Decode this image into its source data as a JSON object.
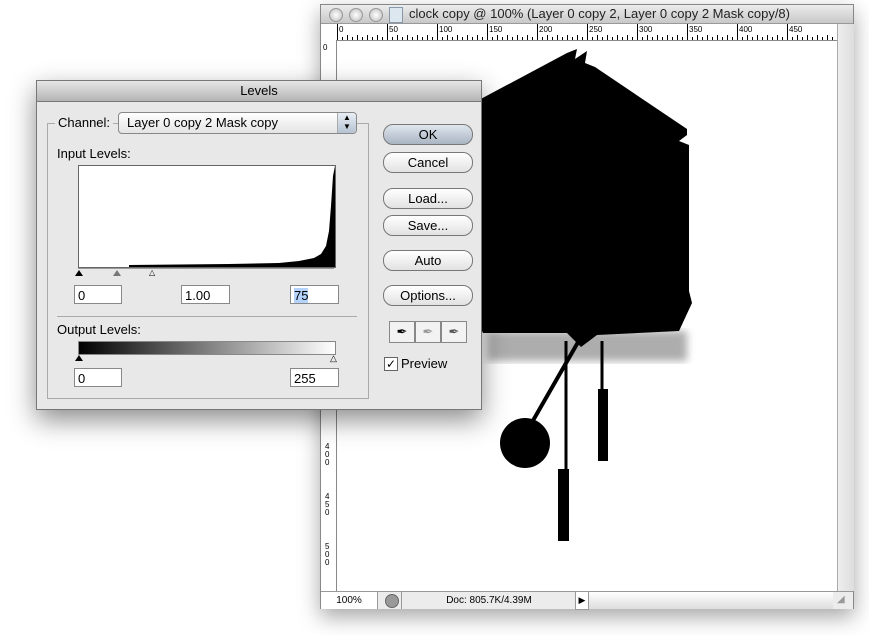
{
  "document": {
    "title": "clock copy @ 100% (Layer 0 copy 2, Layer 0 copy 2 Mask copy/8)",
    "ruler_top": [
      "0",
      "50",
      "100",
      "150",
      "200",
      "250",
      "300",
      "350",
      "400",
      "450"
    ],
    "ruler_left": [
      "0",
      "350",
      "400",
      "450",
      "500"
    ],
    "zoom": "100%",
    "doc_size": "Doc: 805.7K/4.39M"
  },
  "levels": {
    "title": "Levels",
    "channel_label": "Channel:",
    "channel_value": "Layer 0 copy 2 Mask copy",
    "input_levels_label": "Input Levels:",
    "input_black": "0",
    "input_gamma": "1.00",
    "input_white": "75",
    "output_levels_label": "Output Levels:",
    "output_black": "0",
    "output_white": "255",
    "buttons": {
      "ok": "OK",
      "cancel": "Cancel",
      "load": "Load...",
      "save": "Save...",
      "auto": "Auto",
      "options": "Options..."
    },
    "preview_label": "Preview",
    "preview_checked": true
  }
}
